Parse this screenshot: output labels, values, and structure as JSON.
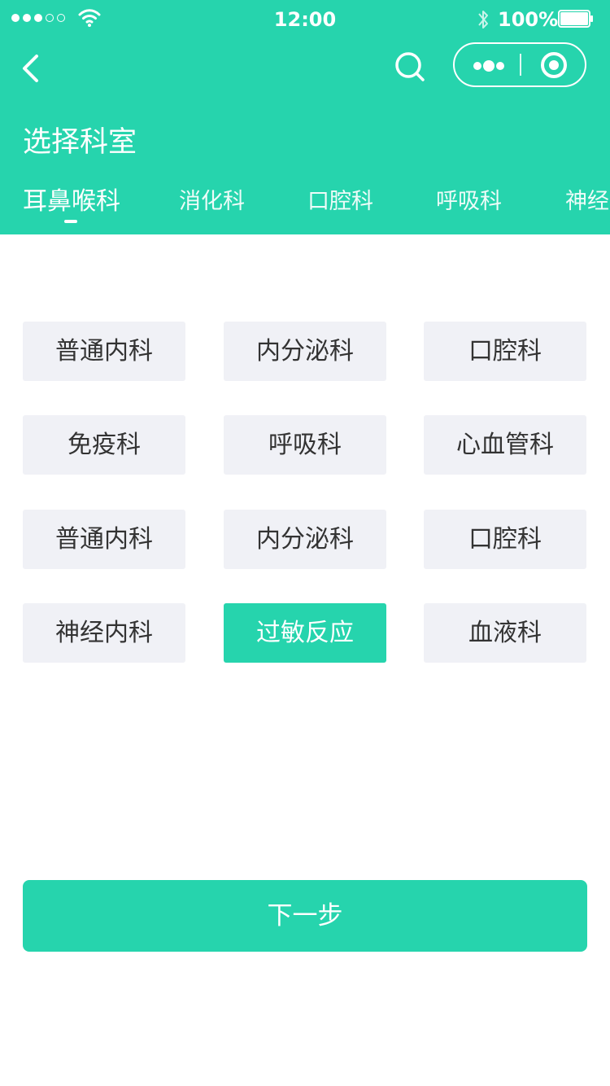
{
  "status_bar": {
    "time": "12:00",
    "battery_percent": "100%",
    "battery_level": 1.0,
    "signal_strength_filled": 3,
    "signal_strength_total": 5,
    "signal_icon": "signal-dots-icon",
    "wifi_icon": "wifi-icon",
    "bluetooth_icon": "bluetooth-icon",
    "battery_icon": "battery-icon"
  },
  "nav": {
    "back_icon": "chevron-left-icon",
    "search_icon": "search-icon",
    "more_icon": "more-dots-icon",
    "close_icon": "target-circle-icon"
  },
  "page": {
    "title": "选择科室"
  },
  "tabs": [
    {
      "label": "耳鼻喉科",
      "active": true
    },
    {
      "label": "消化科",
      "active": false
    },
    {
      "label": "口腔科",
      "active": false
    },
    {
      "label": "呼吸科",
      "active": false
    },
    {
      "label": "神经内科",
      "active": false
    }
  ],
  "departments": [
    {
      "label": "普通内科",
      "selected": false
    },
    {
      "label": "内分泌科",
      "selected": false
    },
    {
      "label": "口腔科",
      "selected": false
    },
    {
      "label": "免疫科",
      "selected": false
    },
    {
      "label": "呼吸科",
      "selected": false
    },
    {
      "label": "心血管科",
      "selected": false
    },
    {
      "label": "普通内科",
      "selected": false
    },
    {
      "label": "内分泌科",
      "selected": false
    },
    {
      "label": "口腔科",
      "selected": false
    },
    {
      "label": "神经内科",
      "selected": false
    },
    {
      "label": "过敏反应",
      "selected": true
    },
    {
      "label": "血液科",
      "selected": false
    }
  ],
  "footer": {
    "next_label": "下一步"
  },
  "colors": {
    "primary": "#26d4ad",
    "option_bg": "#f0f1f6",
    "option_text": "#333333",
    "text_on_primary": "#ffffff",
    "page_bg": "#ffffff"
  }
}
